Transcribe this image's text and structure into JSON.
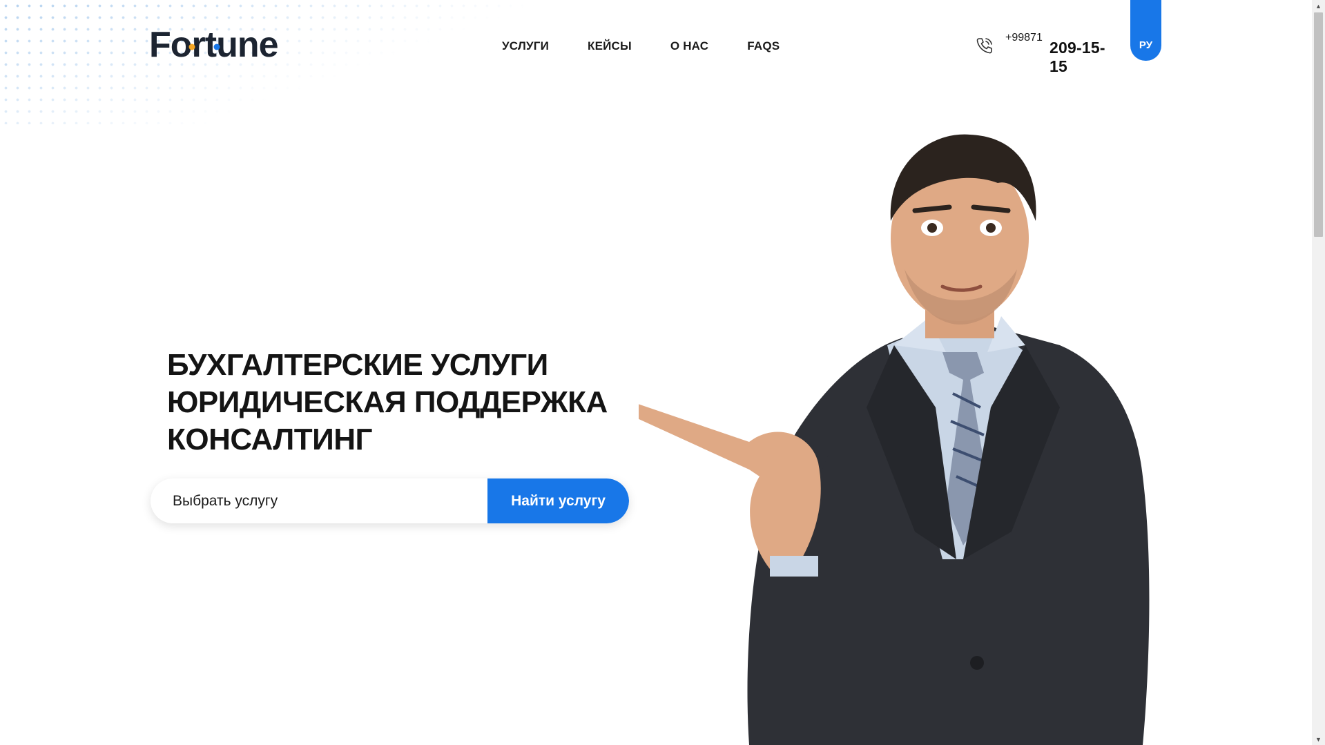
{
  "header": {
    "logo_text": "Fortune",
    "nav": [
      {
        "label": "УСЛУГИ"
      },
      {
        "label": "КЕЙСЫ"
      },
      {
        "label": "О НАС"
      },
      {
        "label": "FAQS"
      }
    ],
    "phone": {
      "code": "+99871",
      "number": "209-15-15",
      "icon": "phone-icon"
    },
    "language": "РУ"
  },
  "hero": {
    "title_lines": [
      "БУХГАЛТЕРСКИЕ УСЛУГИ",
      "ЮРИДИЧЕСКАЯ ПОДДЕРЖКА",
      "КОНСАЛТИНГ"
    ],
    "search": {
      "placeholder": "Выбрать услугу",
      "button_label": "Найти услугу"
    }
  },
  "colors": {
    "accent": "#1877e8",
    "logo_dark": "#1c2431",
    "logo_dot_orange": "#f5a623",
    "text": "#141414"
  }
}
